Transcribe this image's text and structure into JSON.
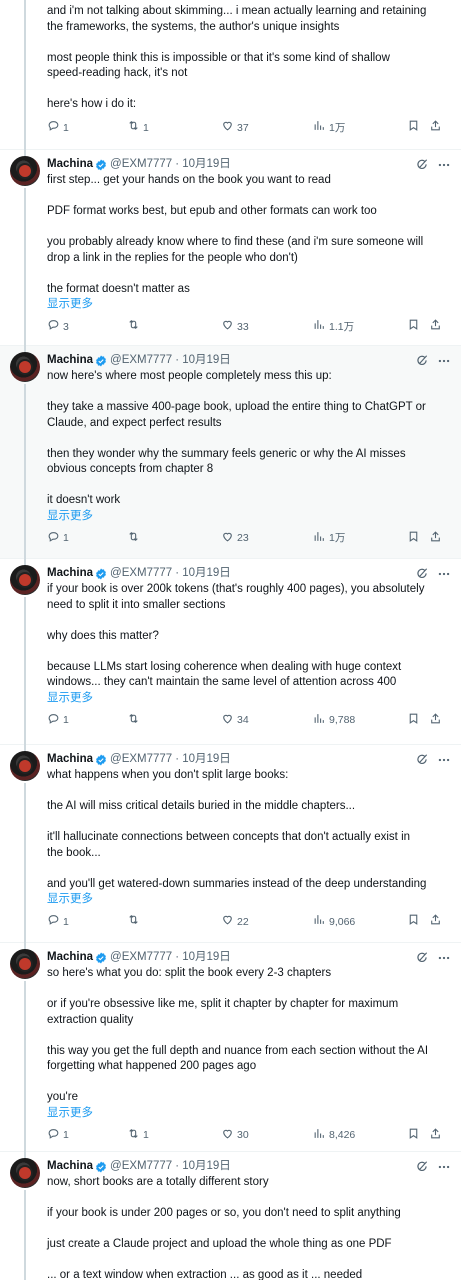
{
  "colors": {
    "accent": "#1d9bf0",
    "muted": "#536471",
    "text": "#0f1419"
  },
  "top_fragment": {
    "lines": [
      "and i'm not talking about skimming... i mean actually learning and retaining",
      "the frameworks, the systems, the author's unique insights",
      "",
      "most people think this is impossible or that it's some kind of shallow",
      "speed-reading hack, it's not",
      "",
      "here's how i do it:"
    ],
    "stats": {
      "replies": "1",
      "reposts": "1",
      "likes": "37",
      "views": "1万"
    }
  },
  "tweets": [
    {
      "name": "Machina",
      "handle": "@EXM7777",
      "date": "· 10月19日",
      "lines": [
        "first step... get your hands on the book you want to read",
        "",
        "PDF format works best, but epub and other formats can work too",
        "",
        "you probably already know where to find these (and i'm sure someone will",
        "drop a link in the replies for the people who don't)",
        "",
        "the format doesn't matter as"
      ],
      "show_more": "显示更多",
      "stats": {
        "replies": "3",
        "reposts": "",
        "likes": "33",
        "views": "1.1万"
      }
    },
    {
      "name": "Machina",
      "handle": "@EXM7777",
      "date": "· 10月19日",
      "lines": [
        "now here's where most people completely mess this up:",
        "",
        "they take a massive 400-page book, upload the entire thing to ChatGPT or",
        "Claude, and expect perfect results",
        "",
        "then they wonder why the summary feels generic or why the AI misses",
        "obvious concepts from chapter 8",
        "",
        "it doesn't work"
      ],
      "show_more": "显示更多",
      "stats": {
        "replies": "1",
        "reposts": "",
        "likes": "23",
        "views": "1万"
      }
    },
    {
      "name": "Machina",
      "handle": "@EXM7777",
      "date": "· 10月19日",
      "lines": [
        "if your book is over 200k tokens (that's roughly 400 pages), you absolutely",
        "need to split it into smaller sections",
        "",
        "why does this matter?",
        "",
        "because LLMs start losing coherence when dealing with huge context",
        "windows... they can't maintain the same level of attention across 400"
      ],
      "show_more": "显示更多",
      "stats": {
        "replies": "1",
        "reposts": "",
        "likes": "34",
        "views": "9,788"
      }
    },
    {
      "name": "Machina",
      "handle": "@EXM7777",
      "date": "· 10月19日",
      "lines": [
        "what happens when you don't split large books:",
        "",
        "the AI will miss critical details buried in the middle chapters...",
        "",
        "it'll hallucinate connections between concepts that don't actually exist in",
        "the book...",
        "",
        "and you'll get watered-down summaries instead of the deep understanding"
      ],
      "show_more": "显示更多",
      "stats": {
        "replies": "1",
        "reposts": "",
        "likes": "22",
        "views": "9,066"
      }
    },
    {
      "name": "Machina",
      "handle": "@EXM7777",
      "date": "· 10月19日",
      "lines": [
        "so here's what you do: split the book every 2-3 chapters",
        "",
        "or if you're obsessive like me, split it chapter by chapter for maximum",
        "extraction quality",
        "",
        "this way you get the full depth and nuance from each section without the AI",
        "forgetting what happened 200 pages ago",
        "",
        "you're"
      ],
      "show_more": "显示更多",
      "stats": {
        "replies": "1",
        "reposts": "1",
        "likes": "30",
        "views": "8,426"
      }
    },
    {
      "name": "Machina",
      "handle": "@EXM7777",
      "date": "· 10月19日",
      "lines": [
        "now, short books are a totally different story",
        "",
        "if your book is under 200 pages or so, you don't need to split anything",
        "",
        "just create a Claude project and upload the whole thing as one PDF",
        "",
        "... or a text window when extraction ... as good as it ... needed"
      ],
      "show_more": "",
      "stats": {
        "replies": "",
        "reposts": "",
        "likes": "",
        "views": ""
      }
    }
  ]
}
